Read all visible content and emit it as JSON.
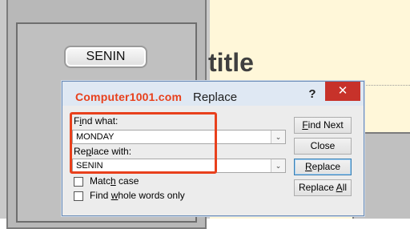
{
  "background": {
    "label_plate": "SENIN",
    "document_title": "title"
  },
  "dialog": {
    "watermark": "Computer1001.com",
    "title": "Replace",
    "help_glyph": "?",
    "close_glyph": "✕",
    "find_label_pre": "F",
    "find_label_ul": "i",
    "find_label_post": "nd what:",
    "find_value": "MONDAY",
    "replace_label_pre": "Re",
    "replace_label_ul": "p",
    "replace_label_post": "lace with:",
    "replace_value": "SENIN",
    "match_case_pre": "Matc",
    "match_case_ul": "h",
    "match_case_post": " case",
    "whole_words_pre": "Find ",
    "whole_words_ul": "w",
    "whole_words_post": "hole words only",
    "buttons": {
      "find_next_pre": "",
      "find_next_ul": "F",
      "find_next_post": "ind Next",
      "close": "Close",
      "replace_pre": "",
      "replace_ul": "R",
      "replace_post": "eplace",
      "replace_all_pre": "Replace ",
      "replace_all_ul": "A",
      "replace_all_post": "ll"
    },
    "dropdown_glyph": "⌄",
    "accent_color": "#e8401c"
  }
}
